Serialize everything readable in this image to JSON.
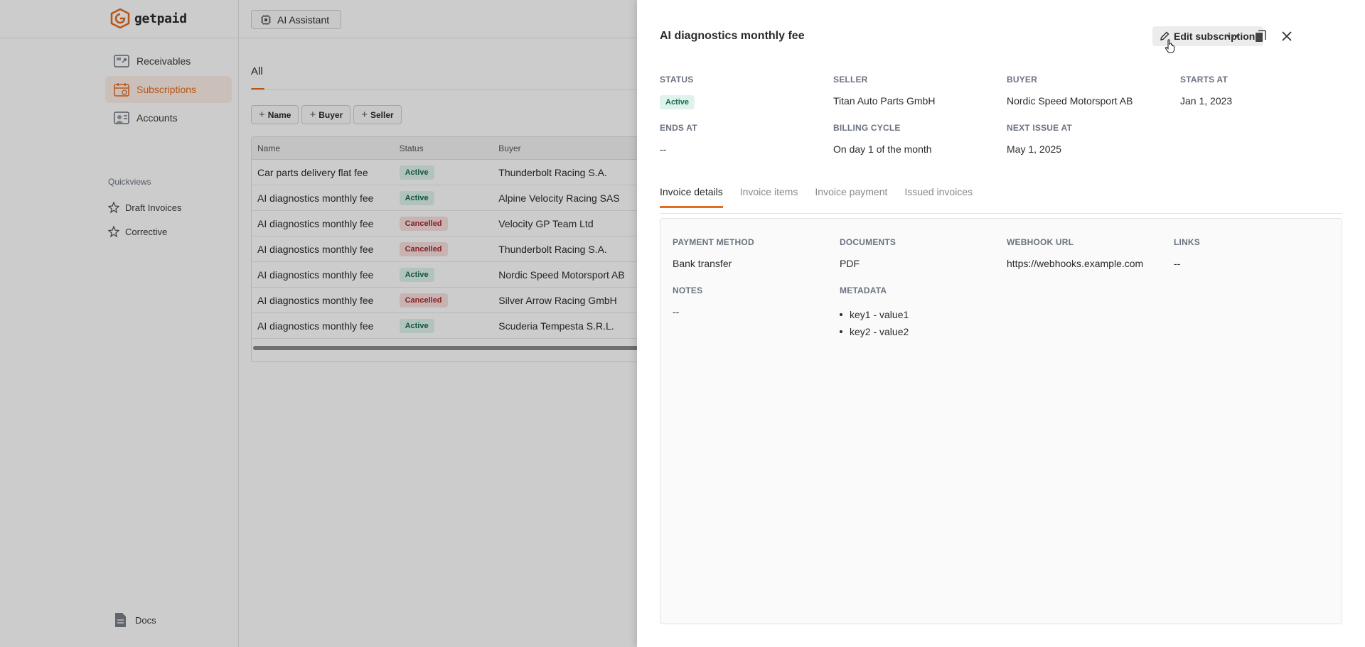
{
  "app": {
    "logo_text": "getpaid"
  },
  "sidebar": {
    "nav": [
      {
        "label": "Receivables",
        "icon": "receivables-icon",
        "active": false
      },
      {
        "label": "Subscriptions",
        "icon": "calendar-icon",
        "active": true
      },
      {
        "label": "Accounts",
        "icon": "accounts-icon",
        "active": false
      }
    ],
    "quickviews_title": "Quickviews",
    "quickviews": [
      {
        "label": "Draft Invoices",
        "icon": "pin-icon"
      },
      {
        "label": "Corrective",
        "icon": "pin-icon"
      }
    ],
    "docs_label": "Docs"
  },
  "topbar": {
    "ai_assistant_label": "AI Assistant"
  },
  "main": {
    "tab_all": "All",
    "filters": [
      "Name",
      "Buyer",
      "Seller"
    ],
    "columns": [
      "Name",
      "Status",
      "Buyer"
    ],
    "rows": [
      {
        "name": "Car parts delivery flat fee",
        "status": "Active",
        "buyer": "Thunderbolt Racing S.A."
      },
      {
        "name": "AI diagnostics monthly fee",
        "status": "Active",
        "buyer": "Alpine Velocity Racing SAS"
      },
      {
        "name": "AI diagnostics monthly fee",
        "status": "Cancelled",
        "buyer": "Velocity GP Team Ltd"
      },
      {
        "name": "AI diagnostics monthly fee",
        "status": "Cancelled",
        "buyer": "Thunderbolt Racing S.A."
      },
      {
        "name": "AI diagnostics monthly fee",
        "status": "Active",
        "buyer": "Nordic Speed Motorsport AB"
      },
      {
        "name": "AI diagnostics monthly fee",
        "status": "Cancelled",
        "buyer": "Silver Arrow Racing GmbH"
      },
      {
        "name": "AI diagnostics monthly fee",
        "status": "Active",
        "buyer": "Scuderia Tempesta S.R.L."
      }
    ]
  },
  "drawer": {
    "title": "AI diagnostics monthly fee",
    "edit_label": "Edit subscription",
    "fields": {
      "status": {
        "label": "STATUS",
        "value": "Active"
      },
      "seller": {
        "label": "SELLER",
        "value": "Titan Auto Parts GmbH"
      },
      "buyer": {
        "label": "BUYER",
        "value": "Nordic Speed Motorsport AB"
      },
      "starts_at": {
        "label": "STARTS AT",
        "value": "Jan 1, 2023"
      },
      "ends_at": {
        "label": "ENDS AT",
        "value": "--"
      },
      "billing_cycle": {
        "label": "BILLING CYCLE",
        "value": "On day 1 of the month"
      },
      "next_issue_at": {
        "label": "NEXT ISSUE AT",
        "value": "May 1, 2025"
      }
    },
    "tabs": [
      "Invoice details",
      "Invoice items",
      "Invoice payment",
      "Issued invoices"
    ],
    "details": {
      "payment_method": {
        "label": "PAYMENT METHOD",
        "value": "Bank transfer"
      },
      "documents": {
        "label": "DOCUMENTS",
        "value": "PDF"
      },
      "webhook_url": {
        "label": "WEBHOOK URL",
        "value": "https://webhooks.example.com"
      },
      "links": {
        "label": "LINKS",
        "value": "--"
      },
      "notes": {
        "label": "NOTES",
        "value": "--"
      },
      "metadata": {
        "label": "METADATA",
        "items": [
          "key1 - value1",
          "key2 - value2"
        ]
      }
    }
  },
  "colors": {
    "accent": "#e56b1f",
    "active_badge_bg": "#dff3ec",
    "active_badge_text": "#1a6b50",
    "cancelled_badge_bg": "#fbe0e0",
    "cancelled_badge_text": "#a8282c"
  }
}
